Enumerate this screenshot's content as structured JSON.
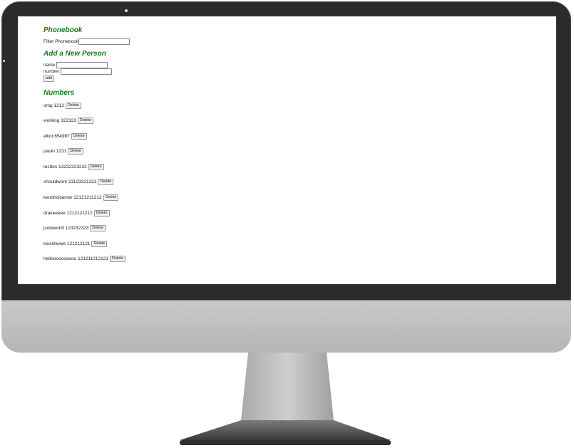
{
  "app": {
    "phonebook_heading": "Phonebook",
    "filter_label": "Filter Phonebook",
    "filter_value": "",
    "add_heading": "Add a New Person",
    "name_label": "name:",
    "name_value": "",
    "number_label": "number:",
    "number_value": "",
    "add_button": "add",
    "numbers_heading": "Numbers",
    "delete_label": "Delete",
    "persons": [
      {
        "name": "omg",
        "number": "1212"
      },
      {
        "name": "working",
        "number": "322323"
      },
      {
        "name": "elliot",
        "number": "654987"
      },
      {
        "name": "paulo",
        "number": "1231"
      },
      {
        "name": "testtes",
        "number": "13232323232"
      },
      {
        "name": "shouldwork",
        "number": "23123321321"
      },
      {
        "name": "kendricklamar",
        "number": "12121211212"
      },
      {
        "name": "drakeeeee",
        "number": "1212121212"
      },
      {
        "name": "jcoleworld",
        "number": "123232323"
      },
      {
        "name": "kevinliwwe",
        "number": "121212121"
      },
      {
        "name": "helloooooooooo",
        "number": "121211212121"
      }
    ]
  },
  "colors": {
    "heading": "#1b7a1b",
    "bezel": "#2b2b2b",
    "chin": "#c0c0c0"
  }
}
